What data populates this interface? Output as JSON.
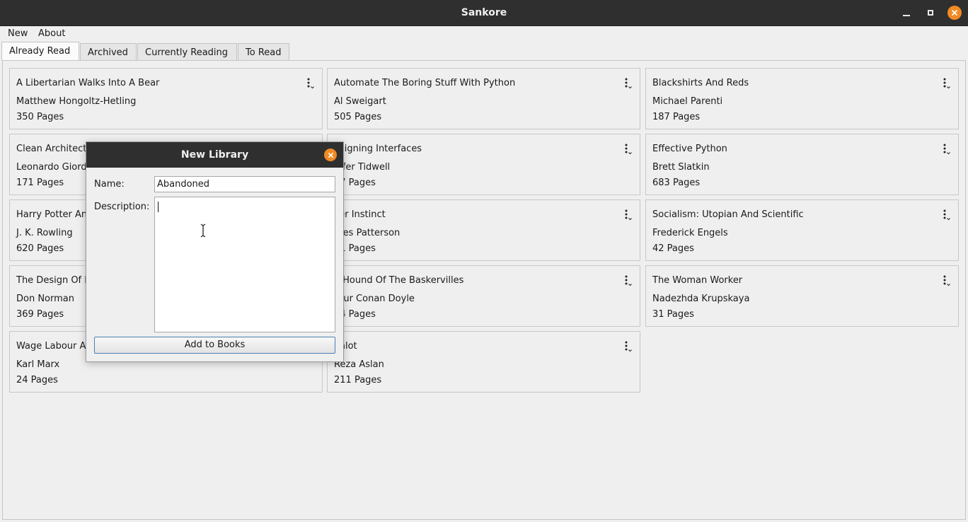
{
  "window": {
    "title": "Sankore"
  },
  "menu": {
    "items": [
      {
        "label": "New"
      },
      {
        "label": "About"
      }
    ]
  },
  "tabs": [
    {
      "label": "Already Read",
      "active": true
    },
    {
      "label": "Archived",
      "active": false
    },
    {
      "label": "Currently Reading",
      "active": false
    },
    {
      "label": "To Read",
      "active": false
    }
  ],
  "books": [
    {
      "title": "A Libertarian Walks Into A Bear",
      "author": "Matthew Hongoltz-Hetling",
      "pages": "350 Pages"
    },
    {
      "title": "Automate The Boring Stuff With Python",
      "author": "Al Sweigart",
      "pages": "505 Pages"
    },
    {
      "title": "Blackshirts And Reds",
      "author": "Michael Parenti",
      "pages": "187 Pages"
    },
    {
      "title": "Clean Architect",
      "author": "Leonardo Giord",
      "pages": "171 Pages"
    },
    {
      "title": "esigning Interfaces",
      "author": "nifer Tidwell",
      "pages": "77 Pages"
    },
    {
      "title": "Effective Python",
      "author": "Brett Slatkin",
      "pages": "683 Pages"
    },
    {
      "title": "Harry Potter An",
      "author": "J. K. Rowling",
      "pages": "620 Pages"
    },
    {
      "title": "ller Instinct",
      "author": "mes Patterson",
      "pages": "31 Pages"
    },
    {
      "title": "Socialism: Utopian And Scientific",
      "author": "Frederick Engels",
      "pages": "42 Pages"
    },
    {
      "title": "The Design Of E",
      "author": "Don Norman",
      "pages": "369 Pages"
    },
    {
      "title": "e Hound Of The Baskervilles",
      "author": "thur Conan Doyle",
      "pages": "74 Pages"
    },
    {
      "title": "The Woman Worker",
      "author": "Nadezhda Krupskaya",
      "pages": "31 Pages"
    },
    {
      "title": "Wage Labour A",
      "author": "Karl Marx",
      "pages": "24 Pages"
    },
    {
      "title": "ealot",
      "author": "Reza Aslan",
      "pages": "211 Pages"
    }
  ],
  "dialog": {
    "title": "New Library",
    "name_label": "Name:",
    "name_value": "Abandoned",
    "description_label": "Description:",
    "description_value": "",
    "submit_label": "Add to Books"
  },
  "colors": {
    "accent": "#f08a24",
    "titlebar": "#2f2f2f",
    "background": "#efefef"
  }
}
